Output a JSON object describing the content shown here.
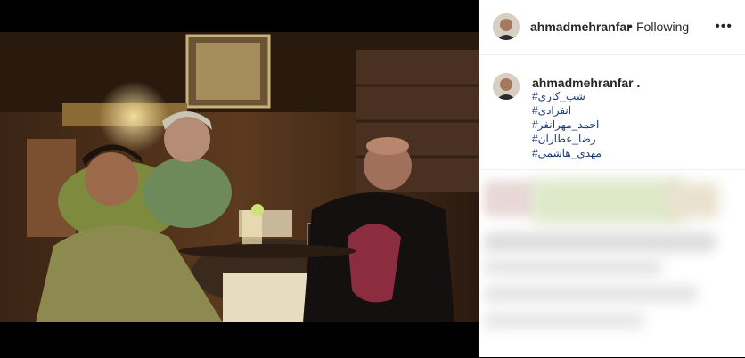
{
  "post": {
    "username": "ahmadmehranfar",
    "separator": "•",
    "follow_status": "Following",
    "more_icon": "more-options-icon",
    "caption_username": "ahmadmehranfar .",
    "hashtags": [
      "شب_کاری#",
      "انفرادی#",
      "احمد_مهرانفر#",
      "رضا_عطاران#",
      "مهدی_هاشمی#"
    ]
  },
  "colors": {
    "accent": "#1b3a75",
    "text": "#262626",
    "background": "#ffffff"
  }
}
